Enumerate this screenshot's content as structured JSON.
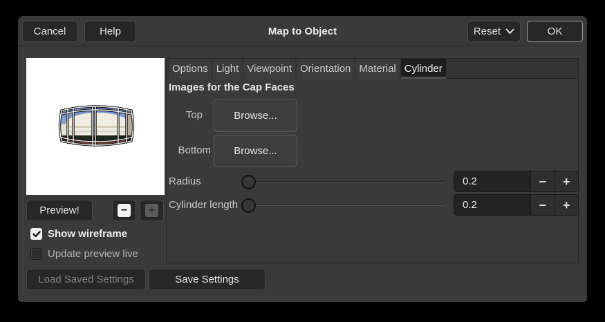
{
  "dialog_title": "Map to Object",
  "header": {
    "cancel_label": "Cancel",
    "help_label": "Help",
    "reset_label": "Reset",
    "ok_label": "OK"
  },
  "tabs": [
    "Options",
    "Light",
    "Viewpoint",
    "Orientation",
    "Material",
    "Cylinder"
  ],
  "active_tab": "Cylinder",
  "cylinder_tab": {
    "section_title": "Images for the Cap Faces",
    "top_label": "Top",
    "bottom_label": "Bottom",
    "browse_top_label": "Browse...",
    "browse_bottom_label": "Browse...",
    "radius_label": "Radius",
    "radius_value": "0.2",
    "cylinder_length_label": "Cylinder length",
    "cylinder_length_value": "0.2"
  },
  "left_panel": {
    "preview_button_label": "Preview!",
    "show_wireframe_label": "Show wireframe",
    "show_wireframe_checked": true,
    "update_preview_live_label": "Update preview live",
    "update_preview_live_checked": false
  },
  "footer": {
    "load_label": "Load Saved Settings",
    "load_enabled": false,
    "save_label": "Save Settings"
  },
  "icons": {
    "minus": "−",
    "plus": "+",
    "zoom_out": "−",
    "zoom_in": "+",
    "chevron_down": "v",
    "check": "✓"
  },
  "colors": {
    "dialog_bg": "#3a3a3a",
    "button_bg": "#272727",
    "active_tab_bg": "#1e1e1e",
    "entry_bg": "#232323",
    "focus_border": "#9c9c9c",
    "preview_bg": "#ffffff"
  }
}
